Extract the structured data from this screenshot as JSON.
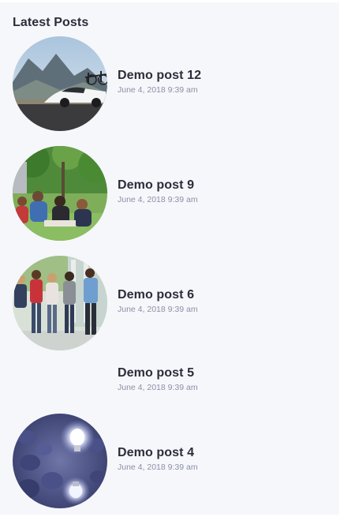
{
  "widget": {
    "title": "Latest Posts"
  },
  "posts": [
    {
      "title": "Demo post 12",
      "date": "June 4, 2018 9:39 am",
      "image": "car-road-mountains"
    },
    {
      "title": "Demo post 9",
      "date": "June 4, 2018 9:39 am",
      "image": "students-on-grass"
    },
    {
      "title": "Demo post 6",
      "date": "June 4, 2018 9:39 am",
      "image": "students-walking"
    },
    {
      "title": "Demo post 5",
      "date": "June 4, 2018 9:39 am",
      "image": ""
    },
    {
      "title": "Demo post 4",
      "date": "June 4, 2018 9:39 am",
      "image": "light-bulbs"
    }
  ]
}
